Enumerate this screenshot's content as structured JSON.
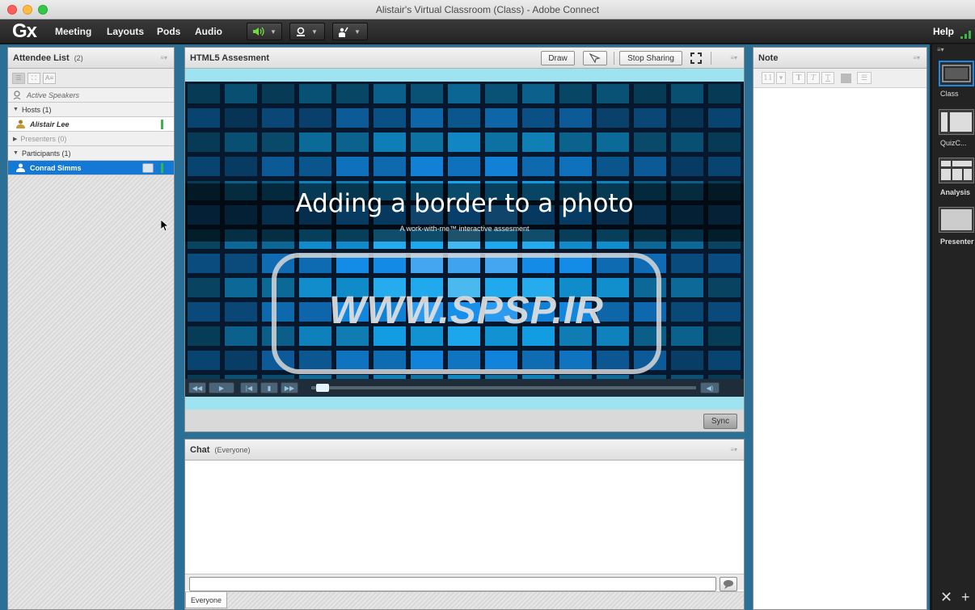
{
  "window": {
    "title": "Alistair's Virtual Classroom (Class) - Adobe Connect"
  },
  "menubar": {
    "logo": "Gx",
    "items": [
      "Meeting",
      "Layouts",
      "Pods",
      "Audio"
    ],
    "help": "Help"
  },
  "attendee_list": {
    "title": "Attendee List",
    "count": "(2)",
    "active_speakers": "Active Speakers",
    "hosts_header": "Hosts (1)",
    "host_name": "Alistair Lee",
    "presenters_header": "Presenters (0)",
    "participants_header": "Participants (1)",
    "participant_name": "Conrad Simms"
  },
  "share_pod": {
    "title": "HTML5 Assesment",
    "draw_label": "Draw",
    "stop_sharing_label": "Stop Sharing",
    "sync_label": "Sync",
    "slide_title": "Adding a border to a photo",
    "slide_subtitle": "A work-with-me™ interactive assesment",
    "watermark": "WWW.SPSP.IR",
    "progress": 0.02
  },
  "chat_pod": {
    "title": "Chat",
    "scope": "(Everyone)",
    "tab_label": "Everyone",
    "input_value": ""
  },
  "note_pod": {
    "title": "Note",
    "font_size": "11"
  },
  "layouts": {
    "items": [
      "Class",
      "QuizC...",
      "Analysis",
      "Presenter"
    ],
    "selected": "Class"
  },
  "colors": {
    "workspace_blue": "#2a6f96",
    "selection_blue": "#1479d4",
    "speaking_green": "#39b54a"
  }
}
